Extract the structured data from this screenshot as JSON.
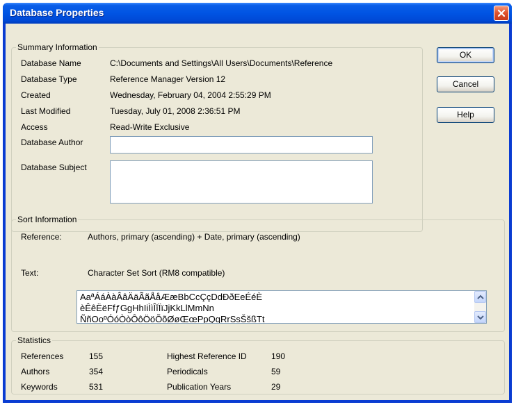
{
  "window": {
    "title": "Database Properties"
  },
  "summary": {
    "legend": "Summary Information",
    "rows": [
      {
        "label": "Database Name",
        "value": "C:\\Documents and Settings\\All Users\\Documents\\Reference"
      },
      {
        "label": "Database Type",
        "value": "Reference Manager Version 12"
      },
      {
        "label": "Created",
        "value": "Wednesday, February 04, 2004 2:55:29 PM"
      },
      {
        "label": "Last Modified",
        "value": "Tuesday, July 01, 2008 2:36:51 PM"
      },
      {
        "label": "Access",
        "value": "Read-Write Exclusive"
      }
    ],
    "author_label": "Database Author",
    "author_value": "",
    "subject_label": "Database Subject",
    "subject_value": ""
  },
  "buttons": {
    "ok": "OK",
    "cancel": "Cancel",
    "help": "Help"
  },
  "sort": {
    "legend": "Sort Information",
    "reference_label": "Reference:",
    "reference_value": "Authors, primary (ascending) + Date, primary (ascending)",
    "text_label": "Text:",
    "text_value": "Character Set Sort (RM8 compatible)",
    "charset_lines": [
      "AaªÁáÀàÂâÄäÃãÅåÆæBbCcÇçDdÐðEeÉéÈ",
      "èÊêËëFfƒGgHhIiÌìÎîÏïJjKkLlMmNn",
      "ÑñOoºÓóÒòÔôÖöÕõØøŒœPpQqRrSsŠšßTt"
    ]
  },
  "statistics": {
    "legend": "Statistics",
    "left": [
      {
        "label": "References",
        "value": "155"
      },
      {
        "label": "Authors",
        "value": "354"
      },
      {
        "label": "Keywords",
        "value": "531"
      }
    ],
    "right": [
      {
        "label": "Highest Reference ID",
        "value": "190"
      },
      {
        "label": "Periodicals",
        "value": "59"
      },
      {
        "label": "Publication Years",
        "value": "29"
      }
    ]
  },
  "icons": {
    "close": "close-icon",
    "scroll_up": "scroll-up-icon",
    "scroll_down": "scroll-down-icon"
  },
  "colors": {
    "titlebar": "#0054e3",
    "dialog_bg": "#ece9d8",
    "close": "#e2552f"
  }
}
